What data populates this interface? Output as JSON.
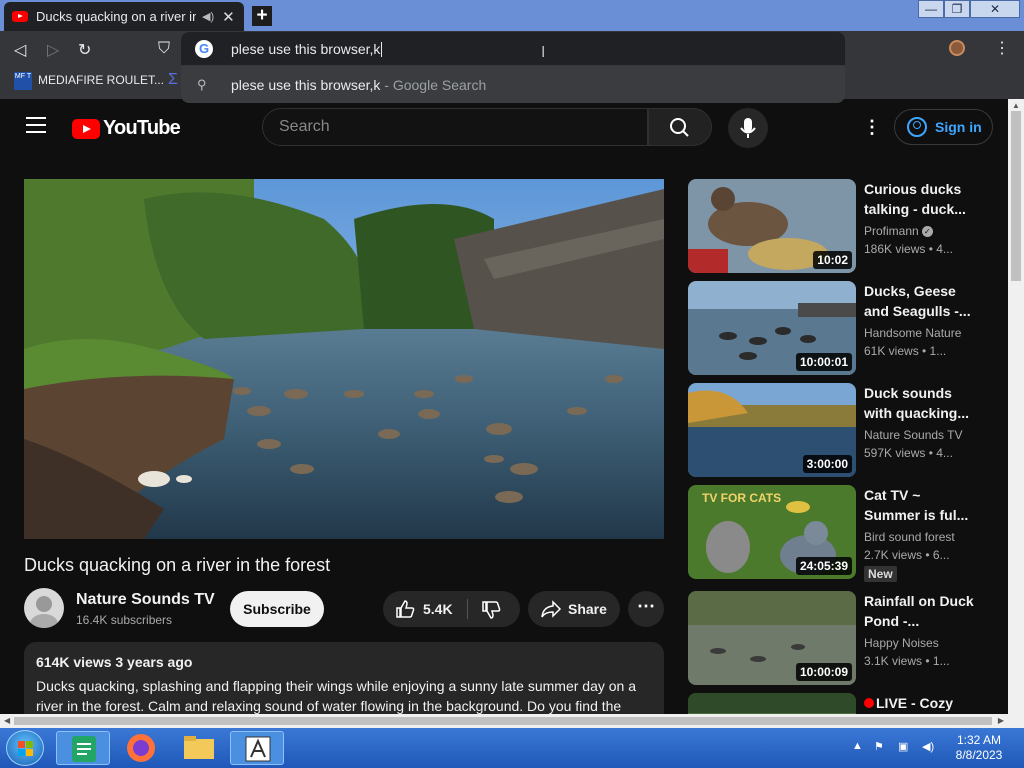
{
  "browser": {
    "tab_title": "Ducks quacking on a river in the forest",
    "omnibox_text": "plese use this browser,k",
    "suggestion_text": "plese use this browser,k",
    "suggestion_suffix": " - Google Search",
    "bookmark_label": "MEDIAFIRE ROULET...",
    "bookmark_icon_text": "MF T"
  },
  "youtube": {
    "logo_text": "YouTube",
    "search_placeholder": "Search",
    "signin_label": "Sign in"
  },
  "video": {
    "title": "Ducks quacking on a river in the forest",
    "channel": "Nature Sounds TV",
    "subscribers": "16.4K subscribers",
    "subscribe_label": "Subscribe",
    "likes": "5.4K",
    "share_label": "Share",
    "views_date": "614K views  3 years ago",
    "description": "Ducks quacking, splashing and flapping their wings while enjoying a sunny late summer day on a river in the forest. Calm and relaxing sound of water flowing in the background. Do you find the"
  },
  "recommendations": [
    {
      "title": "Curious ducks talking - duck...",
      "channel": "Profimann",
      "verified": true,
      "views": "186K views  • 4...",
      "duration": "10:02"
    },
    {
      "title": "Ducks, Geese and Seagulls -...",
      "channel": "Handsome Nature",
      "verified": false,
      "views": "61K views  • 1...",
      "duration": "10:00:01"
    },
    {
      "title": "Duck sounds with quacking...",
      "channel": "Nature Sounds TV",
      "verified": false,
      "views": "597K views  • 4...",
      "duration": "3:00:00"
    },
    {
      "title": "Cat TV ~ Summer is ful...",
      "channel": "Bird sound forest",
      "verified": false,
      "views": "2.7K views  • 6...",
      "duration": "24:05:39",
      "badge": "New",
      "thumb_text": "TV FOR CATS"
    },
    {
      "title": "Rainfall on Duck Pond -...",
      "channel": "Happy Noises",
      "verified": false,
      "views": "3.1K views  • 1...",
      "duration": "10:00:09"
    },
    {
      "title": "LIVE - Cozy",
      "live": true
    }
  ],
  "taskbar": {
    "time": "1:32 AM",
    "date": "8/8/2023"
  },
  "colors": {
    "yt_red": "#ff0000",
    "yt_bg": "#0f0f0f",
    "link_blue": "#3ea6ff",
    "taskbar_blue": "#2a66c8"
  }
}
